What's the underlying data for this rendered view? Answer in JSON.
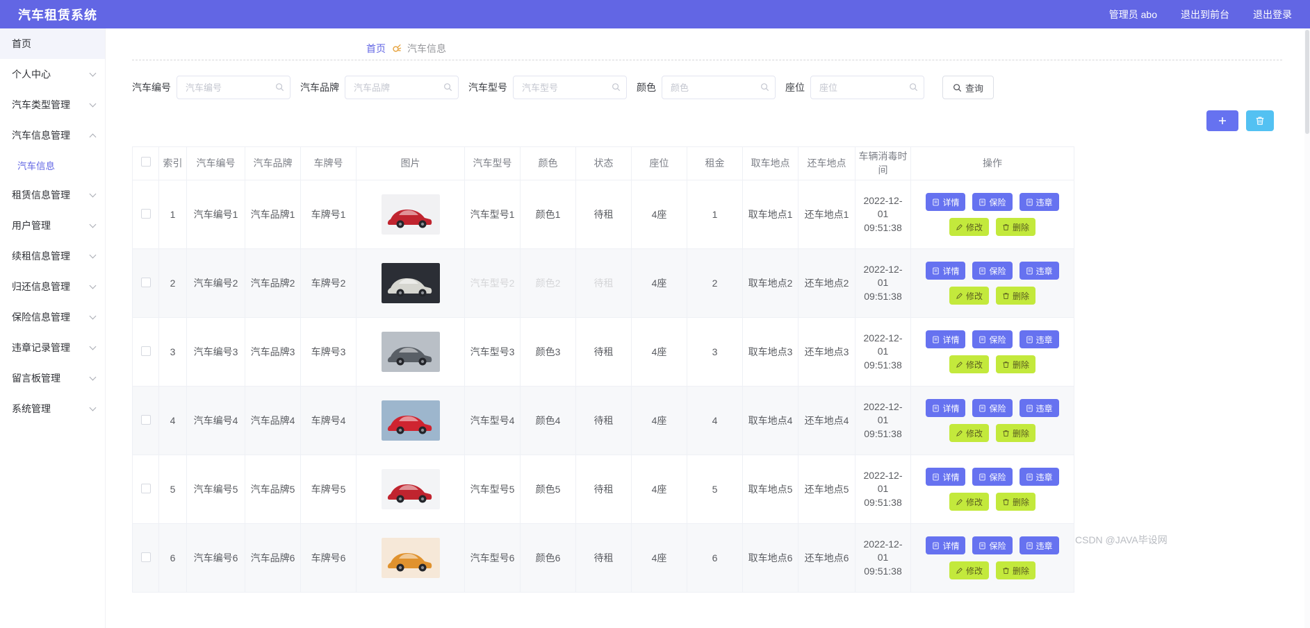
{
  "header": {
    "title": "汽车租赁系统",
    "user": "管理员 abo",
    "link_front": "退出到前台",
    "link_logout": "退出登录"
  },
  "sidebar": {
    "items": [
      {
        "label": "首页",
        "expandable": false,
        "home": true
      },
      {
        "label": "个人中心",
        "expandable": true
      },
      {
        "label": "汽车类型管理",
        "expandable": true
      },
      {
        "label": "汽车信息管理",
        "expandable": true,
        "expanded": true,
        "children": [
          {
            "label": "汽车信息",
            "active": true
          }
        ]
      },
      {
        "label": "租赁信息管理",
        "expandable": true
      },
      {
        "label": "用户管理",
        "expandable": true
      },
      {
        "label": "续租信息管理",
        "expandable": true
      },
      {
        "label": "归还信息管理",
        "expandable": true
      },
      {
        "label": "保险信息管理",
        "expandable": true
      },
      {
        "label": "违章记录管理",
        "expandable": true
      },
      {
        "label": "留言板管理",
        "expandable": true
      },
      {
        "label": "系统管理",
        "expandable": true
      }
    ]
  },
  "breadcrumb": {
    "home": "首页",
    "current": "汽车信息"
  },
  "filters": [
    {
      "label": "汽车编号",
      "placeholder": "汽车编号"
    },
    {
      "label": "汽车品牌",
      "placeholder": "汽车品牌"
    },
    {
      "label": "汽车型号",
      "placeholder": "汽车型号"
    },
    {
      "label": "颜色",
      "placeholder": "颜色"
    },
    {
      "label": "座位",
      "placeholder": "座位"
    }
  ],
  "toolbar": {
    "search_label": "查询"
  },
  "table": {
    "columns": [
      "索引",
      "汽车编号",
      "汽车品牌",
      "车牌号",
      "图片",
      "汽车型号",
      "颜色",
      "状态",
      "座位",
      "租金",
      "取车地点",
      "还车地点",
      "车辆消毒时间",
      "操作"
    ],
    "action_labels": {
      "detail": "详情",
      "insurance": "保险",
      "violation": "违章",
      "edit": "修改",
      "delete": "删除"
    },
    "rows": [
      {
        "index": "1",
        "code": "汽车编号1",
        "brand": "汽车品牌1",
        "plate": "车牌号1",
        "model": "汽车型号1",
        "color": "颜色1",
        "status": "待租",
        "seats": "4座",
        "rent": "1",
        "pickup": "取车地点1",
        "dropoff": "还车地点1",
        "time": "2022-12-01 09:51:38",
        "photo": {
          "bg": "#f1f1f3",
          "body": "#c0242f"
        }
      },
      {
        "index": "2",
        "code": "汽车编号2",
        "brand": "汽车品牌2",
        "plate": "车牌号2",
        "model": "汽车型号2",
        "color": "颜色2",
        "status": "待租",
        "seats": "4座",
        "rent": "2",
        "pickup": "取车地点2",
        "dropoff": "还车地点2",
        "time": "2022-12-01 09:51:38",
        "watermarked": true,
        "photo": {
          "bg": "#2b2e35",
          "body": "#d6d6d0"
        }
      },
      {
        "index": "3",
        "code": "汽车编号3",
        "brand": "汽车品牌3",
        "plate": "车牌号3",
        "model": "汽车型号3",
        "color": "颜色3",
        "status": "待租",
        "seats": "4座",
        "rent": "3",
        "pickup": "取车地点3",
        "dropoff": "还车地点3",
        "time": "2022-12-01 09:51:38",
        "photo": {
          "bg": "#b9bfc6",
          "body": "#595f66"
        }
      },
      {
        "index": "4",
        "code": "汽车编号4",
        "brand": "汽车品牌4",
        "plate": "车牌号4",
        "model": "汽车型号4",
        "color": "颜色4",
        "status": "待租",
        "seats": "4座",
        "rent": "4",
        "pickup": "取车地点4",
        "dropoff": "还车地点4",
        "time": "2022-12-01 09:51:38",
        "photo": {
          "bg": "#9db6cd",
          "body": "#cf2430"
        }
      },
      {
        "index": "5",
        "code": "汽车编号5",
        "brand": "汽车品牌5",
        "plate": "车牌号5",
        "model": "汽车型号5",
        "color": "颜色5",
        "status": "待租",
        "seats": "4座",
        "rent": "5",
        "pickup": "取车地点5",
        "dropoff": "还车地点5",
        "time": "2022-12-01 09:51:38",
        "photo": {
          "bg": "#f3f4f6",
          "body": "#c0242f"
        }
      },
      {
        "index": "6",
        "code": "汽车编号6",
        "brand": "汽车品牌6",
        "plate": "车牌号6",
        "model": "汽车型号6",
        "color": "颜色6",
        "status": "待租",
        "seats": "4座",
        "rent": "6",
        "pickup": "取车地点6",
        "dropoff": "还车地点6",
        "time": "2022-12-01 09:51:38",
        "photo": {
          "bg": "#f6e8d8",
          "body": "#e0922e"
        }
      }
    ]
  },
  "watermark": "CSDN @JAVA毕设网",
  "colors": {
    "accent": "#6266e4",
    "button_purple": "#6672f0",
    "button_green": "#c3e93c",
    "toolbar_blue": "#53c1f2"
  }
}
